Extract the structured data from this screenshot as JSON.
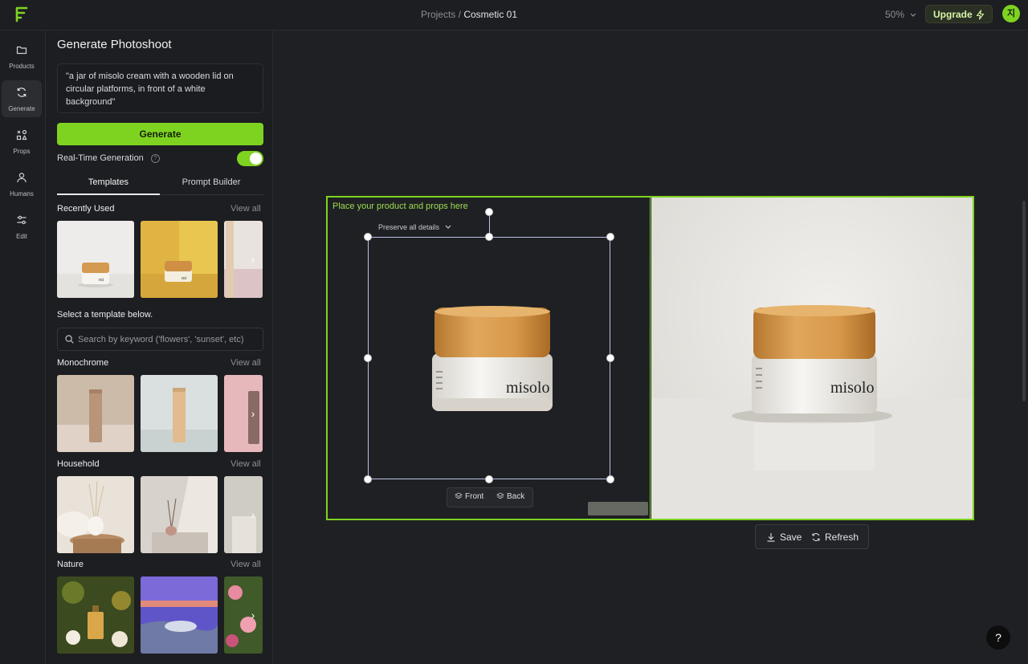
{
  "topbar": {
    "breadcrumb_parent": "Projects",
    "breadcrumb_sep": " / ",
    "breadcrumb_current": "Cosmetic 01",
    "zoom": "50%",
    "upgrade_label": "Upgrade",
    "avatar_initial": "지"
  },
  "rail": {
    "items": [
      {
        "label": "Products",
        "icon": "folder-icon"
      },
      {
        "label": "Generate",
        "icon": "refresh-icon"
      },
      {
        "label": "Props",
        "icon": "shapes-icon"
      },
      {
        "label": "Humans",
        "icon": "person-icon"
      },
      {
        "label": "Edit",
        "icon": "sliders-icon"
      }
    ]
  },
  "sidebar": {
    "title": "Generate Photoshoot",
    "prompt": "\"a jar of misolo cream with a wooden lid on circular platforms, in front of a white background\"",
    "generate_label": "Generate",
    "realtime_label": "Real-Time Generation",
    "realtime_on": true,
    "tabs": [
      "Templates",
      "Prompt Builder"
    ],
    "recently_used": "Recently Used",
    "select_label": "Select a template below.",
    "search_placeholder": "Search by keyword ('flowers', 'sunset', etc)",
    "view_all": "View all",
    "sections": [
      "Monochrome",
      "Household",
      "Nature"
    ]
  },
  "canvas": {
    "place_label": "Place your product and props here",
    "preserve_label": "Preserve all details",
    "front_label": "Front",
    "back_label": "Back",
    "product_brand": "misolo",
    "save_label": "Save",
    "refresh_label": "Refresh",
    "help_label": "?"
  },
  "colors": {
    "accent": "#7ed321",
    "background": "#1f2023",
    "panel": "#1d1e21"
  }
}
